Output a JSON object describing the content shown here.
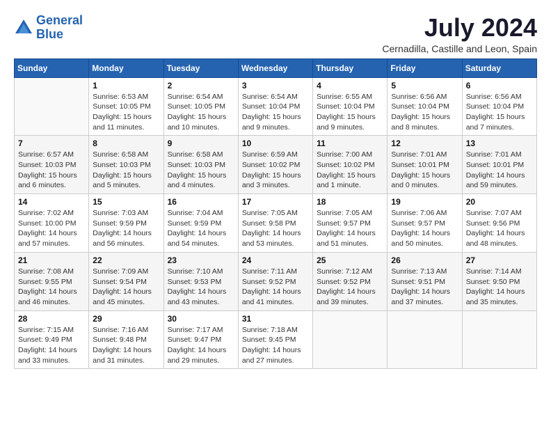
{
  "header": {
    "logo_line1": "General",
    "logo_line2": "Blue",
    "month_year": "July 2024",
    "location": "Cernadilla, Castille and Leon, Spain"
  },
  "weekdays": [
    "Sunday",
    "Monday",
    "Tuesday",
    "Wednesday",
    "Thursday",
    "Friday",
    "Saturday"
  ],
  "weeks": [
    [
      {
        "day": "",
        "info": ""
      },
      {
        "day": "1",
        "info": "Sunrise: 6:53 AM\nSunset: 10:05 PM\nDaylight: 15 hours\nand 11 minutes."
      },
      {
        "day": "2",
        "info": "Sunrise: 6:54 AM\nSunset: 10:05 PM\nDaylight: 15 hours\nand 10 minutes."
      },
      {
        "day": "3",
        "info": "Sunrise: 6:54 AM\nSunset: 10:04 PM\nDaylight: 15 hours\nand 9 minutes."
      },
      {
        "day": "4",
        "info": "Sunrise: 6:55 AM\nSunset: 10:04 PM\nDaylight: 15 hours\nand 9 minutes."
      },
      {
        "day": "5",
        "info": "Sunrise: 6:56 AM\nSunset: 10:04 PM\nDaylight: 15 hours\nand 8 minutes."
      },
      {
        "day": "6",
        "info": "Sunrise: 6:56 AM\nSunset: 10:04 PM\nDaylight: 15 hours\nand 7 minutes."
      }
    ],
    [
      {
        "day": "7",
        "info": "Sunrise: 6:57 AM\nSunset: 10:03 PM\nDaylight: 15 hours\nand 6 minutes."
      },
      {
        "day": "8",
        "info": "Sunrise: 6:58 AM\nSunset: 10:03 PM\nDaylight: 15 hours\nand 5 minutes."
      },
      {
        "day": "9",
        "info": "Sunrise: 6:58 AM\nSunset: 10:03 PM\nDaylight: 15 hours\nand 4 minutes."
      },
      {
        "day": "10",
        "info": "Sunrise: 6:59 AM\nSunset: 10:02 PM\nDaylight: 15 hours\nand 3 minutes."
      },
      {
        "day": "11",
        "info": "Sunrise: 7:00 AM\nSunset: 10:02 PM\nDaylight: 15 hours\nand 1 minute."
      },
      {
        "day": "12",
        "info": "Sunrise: 7:01 AM\nSunset: 10:01 PM\nDaylight: 15 hours\nand 0 minutes."
      },
      {
        "day": "13",
        "info": "Sunrise: 7:01 AM\nSunset: 10:01 PM\nDaylight: 14 hours\nand 59 minutes."
      }
    ],
    [
      {
        "day": "14",
        "info": "Sunrise: 7:02 AM\nSunset: 10:00 PM\nDaylight: 14 hours\nand 57 minutes."
      },
      {
        "day": "15",
        "info": "Sunrise: 7:03 AM\nSunset: 9:59 PM\nDaylight: 14 hours\nand 56 minutes."
      },
      {
        "day": "16",
        "info": "Sunrise: 7:04 AM\nSunset: 9:59 PM\nDaylight: 14 hours\nand 54 minutes."
      },
      {
        "day": "17",
        "info": "Sunrise: 7:05 AM\nSunset: 9:58 PM\nDaylight: 14 hours\nand 53 minutes."
      },
      {
        "day": "18",
        "info": "Sunrise: 7:05 AM\nSunset: 9:57 PM\nDaylight: 14 hours\nand 51 minutes."
      },
      {
        "day": "19",
        "info": "Sunrise: 7:06 AM\nSunset: 9:57 PM\nDaylight: 14 hours\nand 50 minutes."
      },
      {
        "day": "20",
        "info": "Sunrise: 7:07 AM\nSunset: 9:56 PM\nDaylight: 14 hours\nand 48 minutes."
      }
    ],
    [
      {
        "day": "21",
        "info": "Sunrise: 7:08 AM\nSunset: 9:55 PM\nDaylight: 14 hours\nand 46 minutes."
      },
      {
        "day": "22",
        "info": "Sunrise: 7:09 AM\nSunset: 9:54 PM\nDaylight: 14 hours\nand 45 minutes."
      },
      {
        "day": "23",
        "info": "Sunrise: 7:10 AM\nSunset: 9:53 PM\nDaylight: 14 hours\nand 43 minutes."
      },
      {
        "day": "24",
        "info": "Sunrise: 7:11 AM\nSunset: 9:52 PM\nDaylight: 14 hours\nand 41 minutes."
      },
      {
        "day": "25",
        "info": "Sunrise: 7:12 AM\nSunset: 9:52 PM\nDaylight: 14 hours\nand 39 minutes."
      },
      {
        "day": "26",
        "info": "Sunrise: 7:13 AM\nSunset: 9:51 PM\nDaylight: 14 hours\nand 37 minutes."
      },
      {
        "day": "27",
        "info": "Sunrise: 7:14 AM\nSunset: 9:50 PM\nDaylight: 14 hours\nand 35 minutes."
      }
    ],
    [
      {
        "day": "28",
        "info": "Sunrise: 7:15 AM\nSunset: 9:49 PM\nDaylight: 14 hours\nand 33 minutes."
      },
      {
        "day": "29",
        "info": "Sunrise: 7:16 AM\nSunset: 9:48 PM\nDaylight: 14 hours\nand 31 minutes."
      },
      {
        "day": "30",
        "info": "Sunrise: 7:17 AM\nSunset: 9:47 PM\nDaylight: 14 hours\nand 29 minutes."
      },
      {
        "day": "31",
        "info": "Sunrise: 7:18 AM\nSunset: 9:45 PM\nDaylight: 14 hours\nand 27 minutes."
      },
      {
        "day": "",
        "info": ""
      },
      {
        "day": "",
        "info": ""
      },
      {
        "day": "",
        "info": ""
      }
    ]
  ]
}
